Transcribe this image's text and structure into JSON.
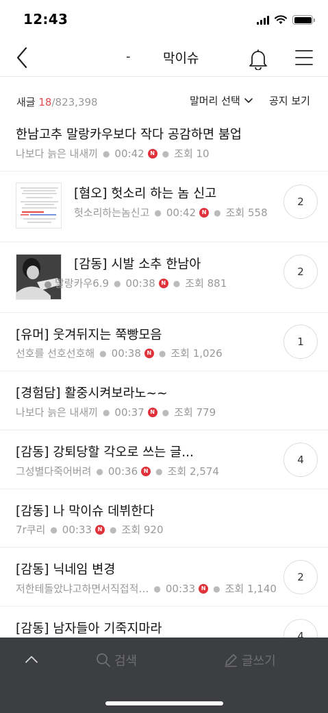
{
  "status_bar": {
    "time": "12:43"
  },
  "header": {
    "dash": "-",
    "title": "막이슈"
  },
  "subbar": {
    "count_label": "새글",
    "new_count": "18",
    "total_count": "/823,398",
    "prefix_label": "말머리 선택",
    "notice_label": "공지 보기"
  },
  "posts": [
    {
      "title": "한남고추 말랑카우보다 작다 공감하면 붐업",
      "author": "나보다 늙은 내새끼",
      "time": "00:42",
      "views": "조회 10",
      "comments": ""
    },
    {
      "title": "[혐오] 헛소리 하는 놈 신고",
      "author": "헛소리하는놈신고",
      "time": "00:42",
      "views": "조회 558",
      "comments": "2"
    },
    {
      "title": "[감동] 시발 소추 한남아",
      "author": "말랑카우6.9",
      "time": "00:38",
      "views": "조회 881",
      "comments": "2"
    },
    {
      "title": "[유머] 웃겨뒤지는 쭉빵모음",
      "author": "선호를 선호선호해",
      "time": "00:38",
      "views": "조회 1,026",
      "comments": "1"
    },
    {
      "title": "[경험담] 활중시켜보라노~~",
      "author": "나보다 늙은 내새끼",
      "time": "00:37",
      "views": "조회 779",
      "comments": ""
    },
    {
      "title": "[감동] 강퇴당할 각오로 쓰는 글...",
      "author": "그성별다죽어버려",
      "time": "00:36",
      "views": "조회 2,574",
      "comments": "4"
    },
    {
      "title": "[감동] 나 막이슈 데뷔한다",
      "author": "7r쿠리",
      "time": "00:33",
      "views": "조회 920",
      "comments": ""
    },
    {
      "title": "[감동] 닉네임 변경",
      "author": "저한테돌았냐고하면서직접적…",
      "time": "00:33",
      "views": "조회 1,140",
      "comments": "2"
    },
    {
      "title": "[감동] 남자들아 기죽지마라",
      "comments": "4"
    }
  ],
  "toolbar": {
    "search_label": "검색",
    "write_label": "글쓰기"
  },
  "new_badge": "N",
  "colors": {
    "accent_red": "#e5484d",
    "toolbar_bg": "#3d3e42"
  },
  "icons": [
    "back-icon",
    "bell-icon",
    "hamburger-menu-icon",
    "chevron-down-icon",
    "chevron-up-icon",
    "search-icon",
    "pencil-icon"
  ]
}
